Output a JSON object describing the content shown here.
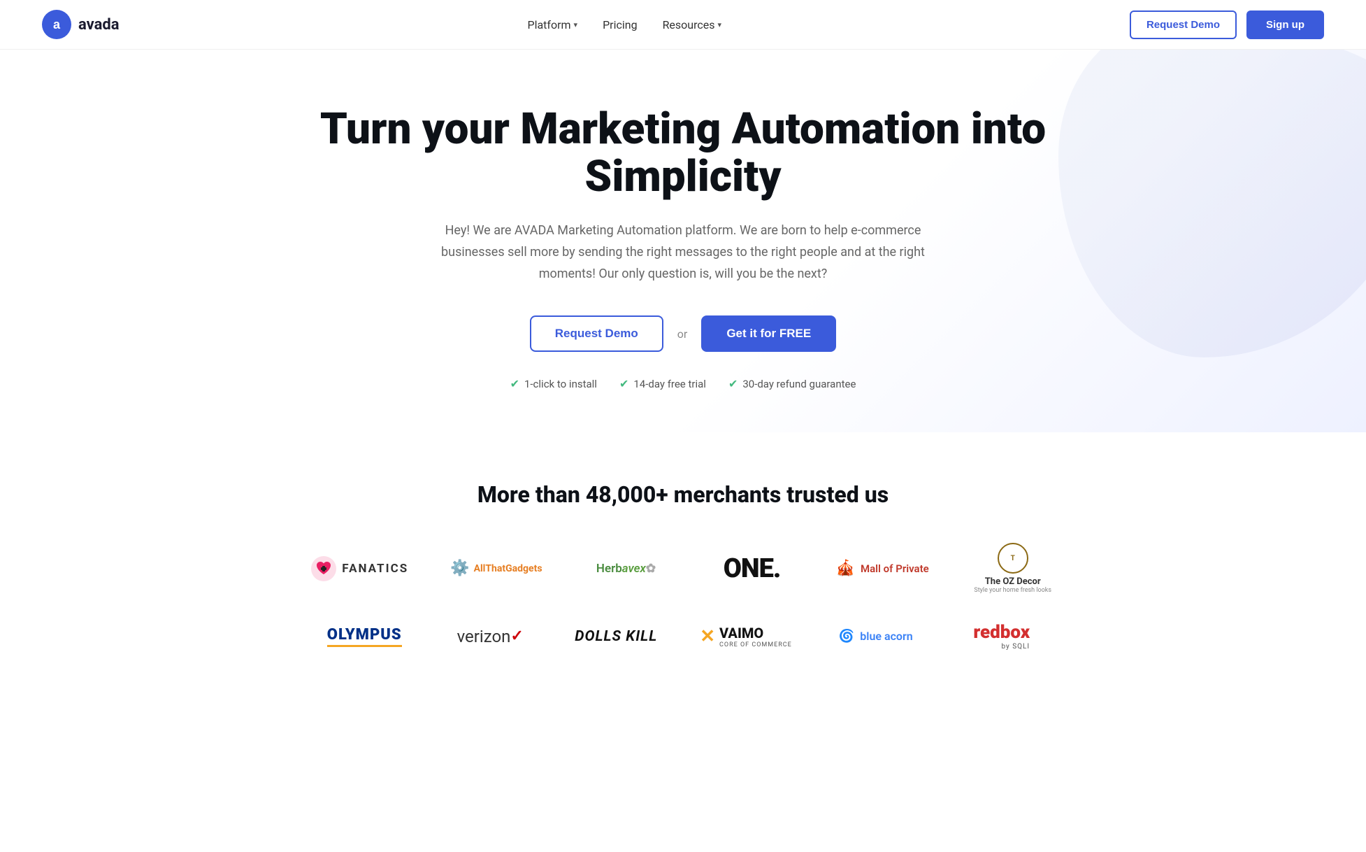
{
  "header": {
    "logo_text": "avada",
    "nav": {
      "platform_label": "Platform",
      "pricing_label": "Pricing",
      "resources_label": "Resources"
    },
    "request_demo_label": "Request Demo",
    "signup_label": "Sign up"
  },
  "hero": {
    "heading": "Turn your Marketing Automation into Simplicity",
    "subheading": "Hey! We are AVADA Marketing Automation platform. We are born to help e-commerce businesses sell more by sending the right messages to the right people and at the right moments! Our only question is, will you be the next?",
    "cta_request_label": "Request Demo",
    "cta_or": "or",
    "cta_get_free_label": "Get it for FREE",
    "badge_install": "1-click to install",
    "badge_trial": "14-day free trial",
    "badge_refund": "30-day refund guarantee"
  },
  "trusted": {
    "title": "More than 48,000+ merchants trusted us",
    "row1": [
      {
        "id": "fanatics",
        "label": "FANATICS"
      },
      {
        "id": "allthat",
        "label": "AllThatGadgets"
      },
      {
        "id": "herbavex",
        "label": "Herbavex"
      },
      {
        "id": "one",
        "label": "ONE."
      },
      {
        "id": "mall",
        "label": "Mall of Private"
      },
      {
        "id": "ozdecor",
        "label": "The OZ Decor"
      }
    ],
    "row2": [
      {
        "id": "olympus",
        "label": "OLYMPUS"
      },
      {
        "id": "verizon",
        "label": "verizon"
      },
      {
        "id": "dolls",
        "label": "DOLLS KILL"
      },
      {
        "id": "vaimo",
        "label": "VAIMO"
      },
      {
        "id": "blueacorn",
        "label": "blue acorn"
      },
      {
        "id": "redbox",
        "label": "redbox by SQLI"
      }
    ]
  }
}
